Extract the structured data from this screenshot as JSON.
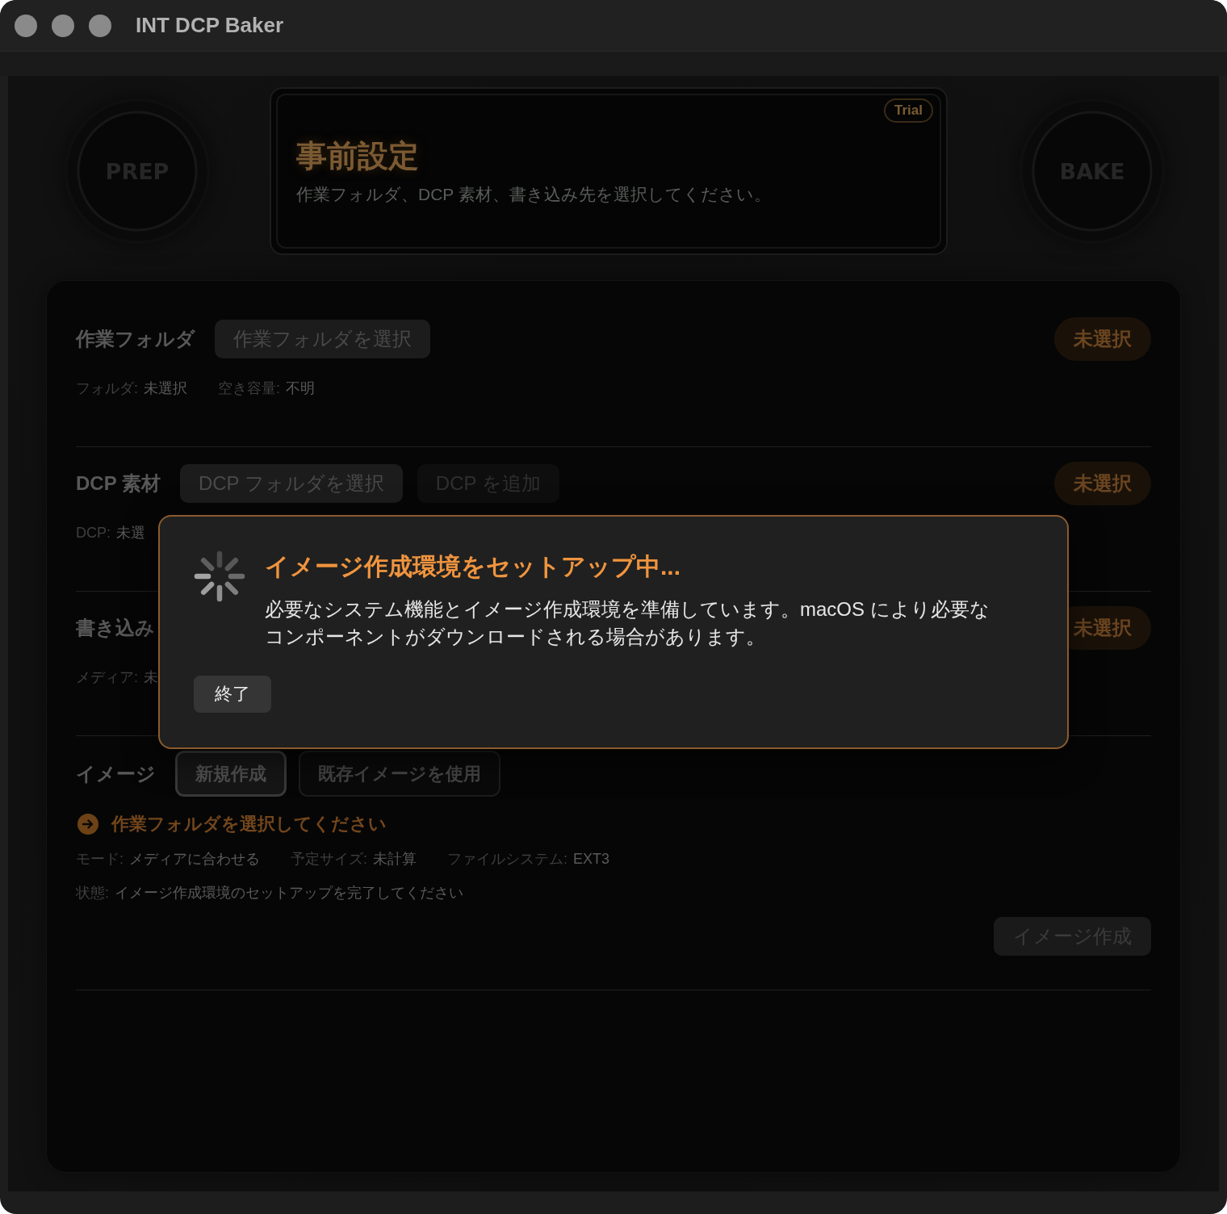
{
  "window": {
    "title": "INT DCP Baker"
  },
  "header": {
    "prep_button": "PREP",
    "status_card": {
      "title": "事前設定",
      "subtitle": "作業フォルダ、DCP 素材、書き込み先を選択してください。",
      "badge": "Trial"
    },
    "bake_button": "BAKE"
  },
  "sections": [
    {
      "label": "作業フォルダ",
      "buttons": [
        {
          "label": "作業フォルダを選択",
          "disabled": false
        }
      ],
      "status": "未選択",
      "info": [
        {
          "key": "フォルダ:",
          "value": "未選択"
        },
        {
          "key": "空き容量:",
          "value": "不明"
        }
      ]
    },
    {
      "label": "DCP 素材",
      "buttons": [
        {
          "label": "DCP フォルダを選択",
          "disabled": false
        },
        {
          "label": "DCP を追加",
          "disabled": true
        }
      ],
      "status": "未選択",
      "info": [
        {
          "key": "DCP:",
          "value": "未選"
        }
      ]
    },
    {
      "label": "書き込み",
      "status": "未選択",
      "info": [
        {
          "key": "メディア:",
          "value": "未"
        }
      ]
    },
    {
      "label": "イメージ",
      "mode_options": [
        {
          "label": "新規作成",
          "selected": true
        },
        {
          "label": "既存イメージを使用",
          "selected": false
        }
      ],
      "hint": "作業フォルダを選択してください",
      "info": [
        {
          "key": "モード:",
          "value": "メディアに合わせる"
        },
        {
          "key": "予定サイズ:",
          "value": "未計算"
        },
        {
          "key": "ファイルシステム:",
          "value": "EXT3"
        }
      ],
      "state": {
        "key": "状態:",
        "value": "イメージ作成環境のセットアップを完了してください"
      },
      "action_button": {
        "label": "イメージ作成",
        "disabled": true
      }
    }
  ],
  "dialog": {
    "title": "イメージ作成環境をセットアップ中...",
    "message": "必要なシステム機能とイメージ作成環境を準備しています。macOS により必要なコンポーネントがダウンロードされる場合があります。",
    "buttons": [
      "終了"
    ]
  }
}
